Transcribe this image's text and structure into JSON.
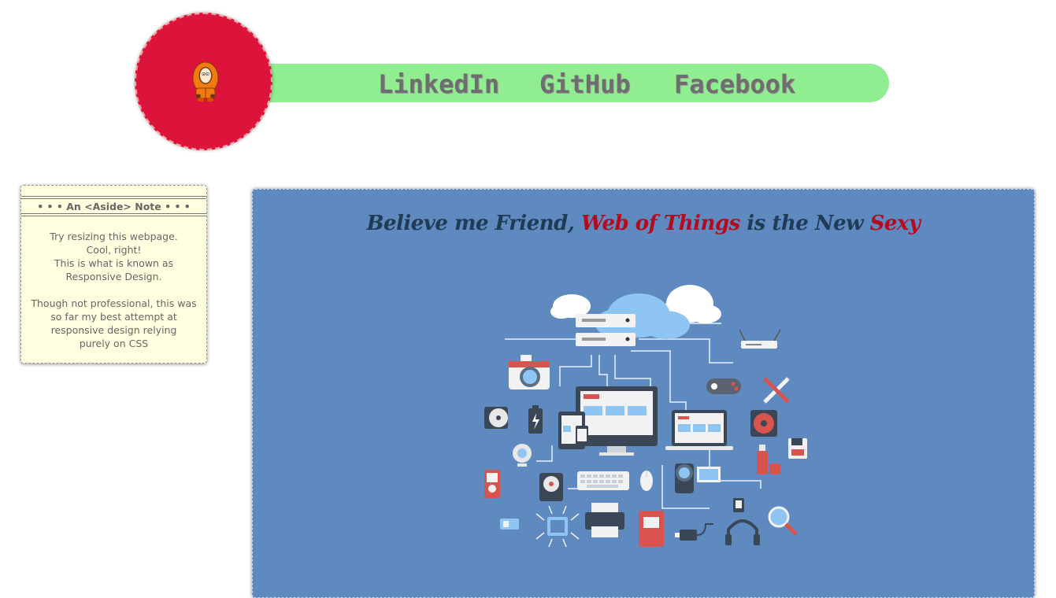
{
  "nav": {
    "links": [
      {
        "label": "LinkedIn"
      },
      {
        "label": "GitHub"
      },
      {
        "label": "Facebook"
      }
    ],
    "bar_color": "#90ee90",
    "logo_color": "#dc143c",
    "logo_icon": "kenny-avatar-icon"
  },
  "aside": {
    "title": "• • • An <Aside> Note • • •",
    "lines": [
      "Try resizing this webpage.",
      "Cool, right!",
      "This is what is known as",
      "Responsive Design."
    ],
    "lines2": [
      "Though not professional, this was",
      "so far my best attempt at",
      "responsive design relying",
      "purely on CSS"
    ],
    "background": "#ffffe0"
  },
  "main": {
    "headline": {
      "part1": "Believe me Friend, ",
      "part2": "Web of Things",
      "part3": " is the New ",
      "part4": "Sexy"
    },
    "background": "#5f8abf",
    "illustration": "internet-of-things-devices-illustration"
  }
}
